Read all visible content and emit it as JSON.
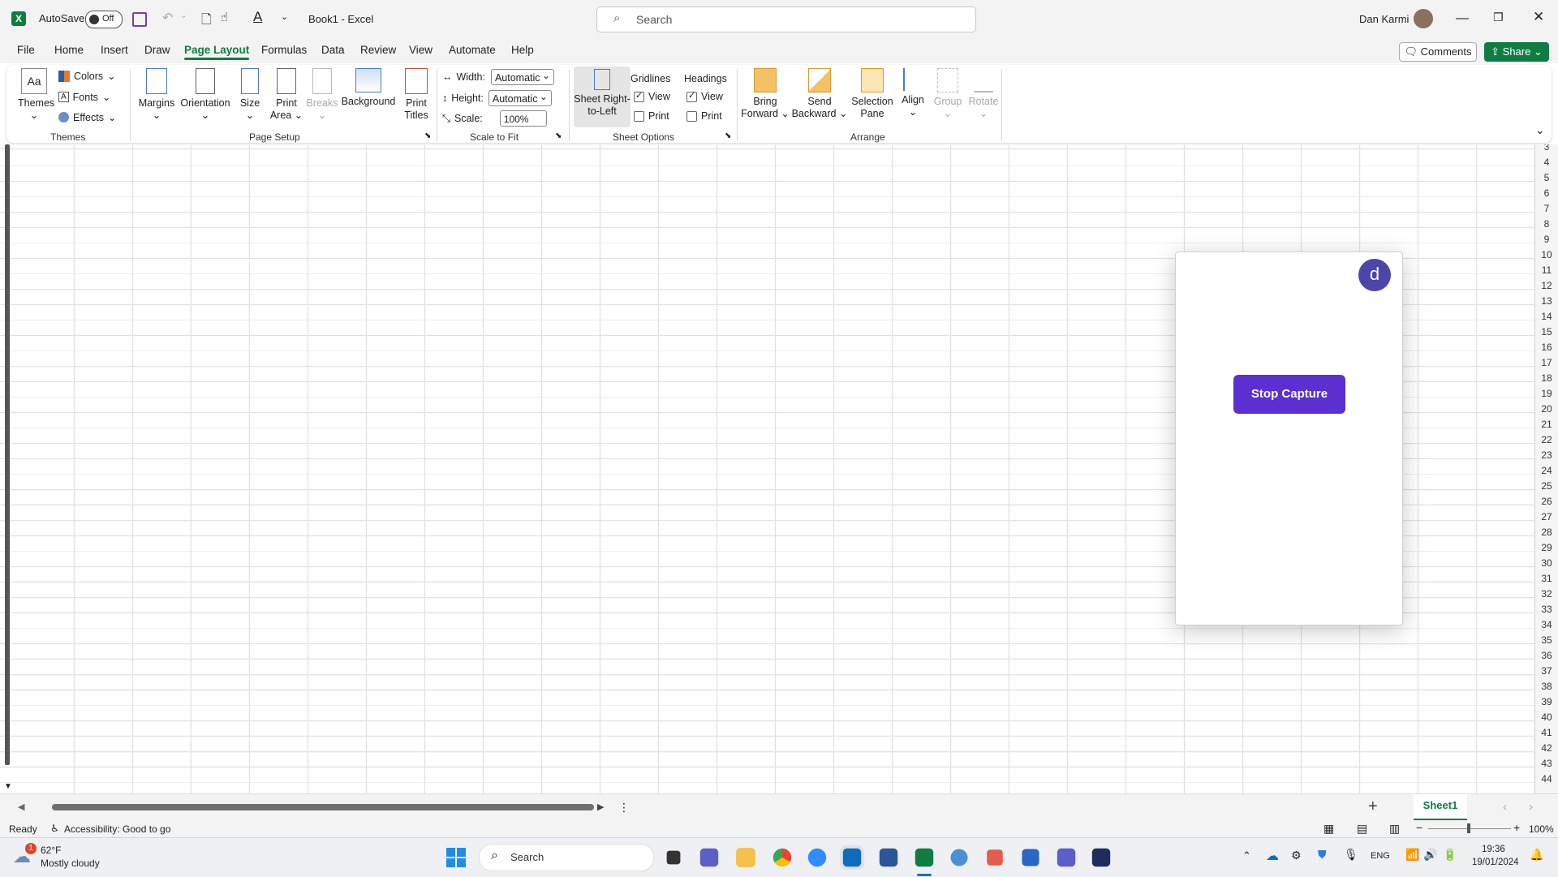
{
  "titlebar": {
    "autosave_label": "AutoSave",
    "autosave_state": "Off",
    "doc_title": "Book1  -  Excel",
    "search_placeholder": "Search",
    "user_name": "Dan Karmi"
  },
  "tabs": [
    "File",
    "Home",
    "Insert",
    "Draw",
    "Page Layout",
    "Formulas",
    "Data",
    "Review",
    "View",
    "Automate",
    "Help"
  ],
  "active_tab": "Page Layout",
  "header_buttons": {
    "comments": "Comments",
    "share": "Share"
  },
  "ribbon": {
    "themes": {
      "themes": "Themes",
      "colors": "Colors",
      "fonts": "Fonts",
      "effects": "Effects",
      "group": "Themes"
    },
    "page_setup": {
      "margins": "Margins",
      "orientation": "Orientation",
      "size": "Size",
      "print_area_1": "Print",
      "print_area_2": "Area",
      "breaks": "Breaks",
      "background": "Background",
      "print_titles_1": "Print",
      "print_titles_2": "Titles",
      "group": "Page Setup"
    },
    "scale": {
      "width_label": "Width:",
      "width_value": "Automatic",
      "height_label": "Height:",
      "height_value": "Automatic",
      "scale_label": "Scale:",
      "scale_value": "100%",
      "group": "Scale to Fit"
    },
    "sheet_options": {
      "rtl_1": "Sheet Right-",
      "rtl_2": "to-Left",
      "gridlines": "Gridlines",
      "headings": "Headings",
      "view": "View",
      "print": "Print",
      "group": "Sheet Options"
    },
    "arrange": {
      "bring_1": "Bring",
      "bring_2": "Forward",
      "send_1": "Send",
      "send_2": "Backward",
      "sel_1": "Selection",
      "sel_2": "Pane",
      "align": "Align",
      "group_btn": "Group",
      "rotate": "Rotate",
      "group": "Arrange"
    }
  },
  "row_numbers": [
    "3",
    "4",
    "5",
    "6",
    "7",
    "8",
    "9",
    "10",
    "11",
    "12",
    "13",
    "14",
    "15",
    "16",
    "17",
    "18",
    "19",
    "20",
    "21",
    "22",
    "23",
    "24",
    "25",
    "26",
    "27",
    "28",
    "29",
    "30",
    "31",
    "32",
    "33",
    "34",
    "35",
    "36",
    "37",
    "38",
    "39",
    "40",
    "41",
    "42",
    "43",
    "44"
  ],
  "popup": {
    "avatar_letter": "d",
    "button": "Stop Capture"
  },
  "sheet_tab": "Sheet1",
  "status": {
    "ready": "Ready",
    "accessibility": "Accessibility: Good to go",
    "zoom": "100%"
  },
  "taskbar": {
    "weather_temp": "62°F",
    "weather_desc": "Mostly cloudy",
    "weather_badge": "1",
    "search": "Search",
    "language": "ENG",
    "time": "19:36",
    "date": "19/01/2024"
  },
  "colors": {
    "excel_green": "#107c41",
    "capture_purple": "#5b2fd0",
    "avatar_indigo": "#4b47a8"
  }
}
